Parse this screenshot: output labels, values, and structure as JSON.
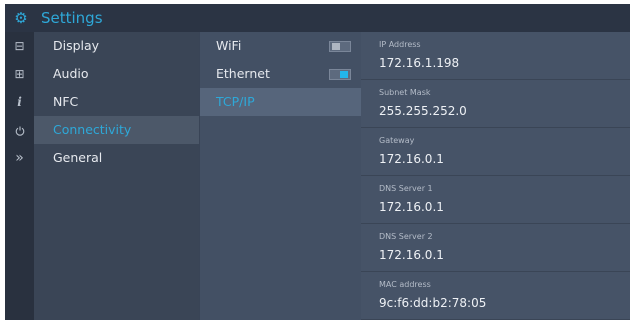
{
  "header": {
    "title": "Settings",
    "icon": "gear-icon"
  },
  "rail": {
    "icons": [
      {
        "name": "display-icon",
        "glyph": "⊟"
      },
      {
        "name": "audio-icon",
        "glyph": "⊞"
      },
      {
        "name": "info-icon",
        "glyph": "i"
      },
      {
        "name": "power-icon",
        "glyph": "⏻"
      },
      {
        "name": "chevron-right-icon",
        "glyph": "»"
      }
    ]
  },
  "menu": {
    "items": [
      {
        "label": "Display",
        "active": false
      },
      {
        "label": "Audio",
        "active": false
      },
      {
        "label": "NFC",
        "active": false
      },
      {
        "label": "Connectivity",
        "active": true
      },
      {
        "label": "General",
        "active": false
      }
    ]
  },
  "submenu": {
    "items": [
      {
        "label": "WiFi",
        "toggle": "off"
      },
      {
        "label": "Ethernet",
        "toggle": "on"
      },
      {
        "label": "TCP/IP",
        "active": true
      }
    ]
  },
  "details": {
    "fields": [
      {
        "label": "IP Address",
        "value": "172.16.1.198"
      },
      {
        "label": "Subnet Mask",
        "value": "255.255.252.0"
      },
      {
        "label": "Gateway",
        "value": "172.16.0.1"
      },
      {
        "label": "DNS Server 1",
        "value": "172.16.0.1"
      },
      {
        "label": "DNS Server 2",
        "value": "172.16.0.1"
      },
      {
        "label": "MAC address",
        "value": "9c:f6:dd:b2:78:05"
      }
    ]
  },
  "colors": {
    "accent": "#2ea8d8",
    "titlebar": "#2b3444",
    "menu_bg": "#3a4556",
    "toggle_on": "#22b5ea"
  }
}
